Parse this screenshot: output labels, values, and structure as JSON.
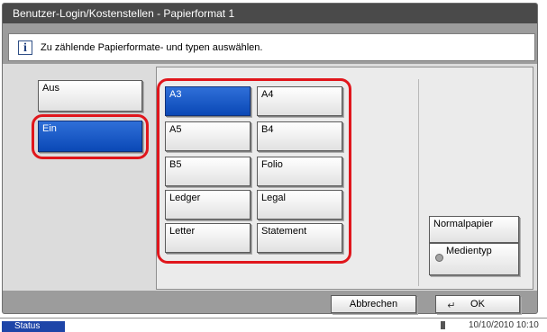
{
  "header": {
    "title": "Benutzer-Login/Kostenstellen - Papierformat 1"
  },
  "info": {
    "icon": "info-icon",
    "glyph": "i",
    "message": "Zu zählende Papierformate- und typen auswählen."
  },
  "toggle": {
    "off_label": "Aus",
    "on_label": "Ein",
    "selected": "Ein"
  },
  "paper_sizes": {
    "a3": "A3",
    "a4": "A4",
    "a5": "A5",
    "b4": "B4",
    "b5": "B5",
    "folio": "Folio",
    "ledger": "Ledger",
    "legal": "Legal",
    "letter": "Letter",
    "statement": "Statement",
    "selected": "A3"
  },
  "media": {
    "value": "Normalpapier",
    "button_label": "Medientyp"
  },
  "footer": {
    "cancel_label": "Abbrechen",
    "ok_label": "OK",
    "enter_glyph": "↵"
  },
  "status": {
    "button_label": "Status",
    "datetime": "10/10/2010  10:10"
  },
  "colors": {
    "selected": "#0a48b6",
    "highlight": "#e0161c",
    "status": "#1e45a8"
  }
}
